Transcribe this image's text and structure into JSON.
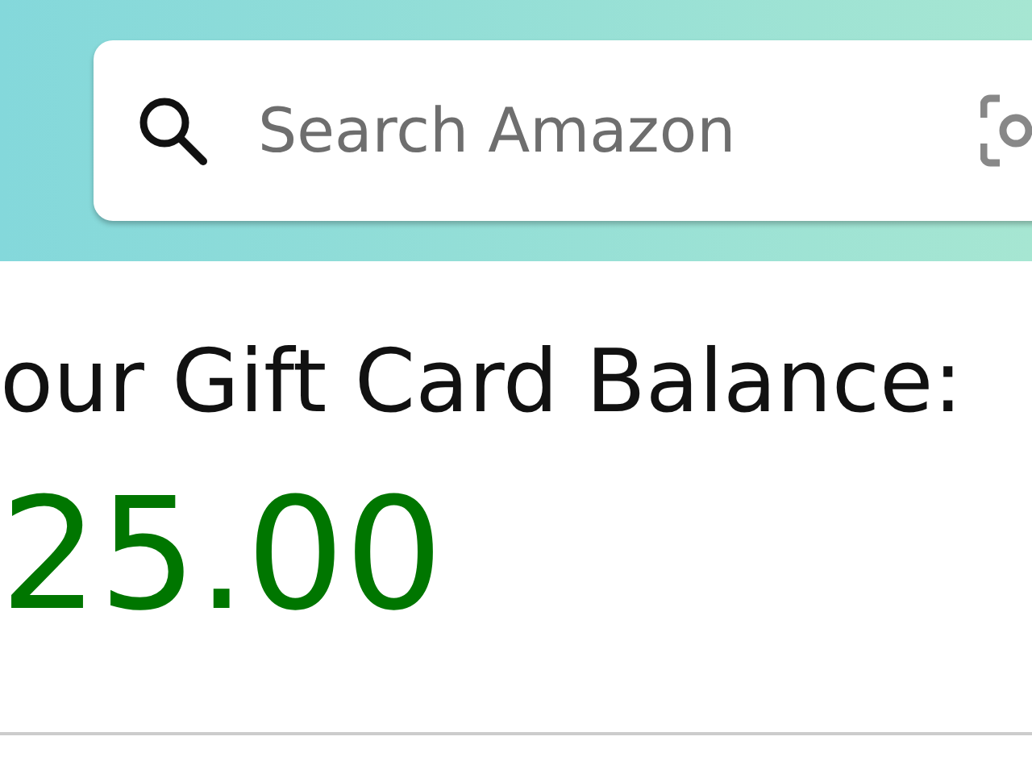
{
  "search": {
    "placeholder": "Search Amazon"
  },
  "balance": {
    "label": "our Gift Card Balance:",
    "amount": "25.00"
  }
}
